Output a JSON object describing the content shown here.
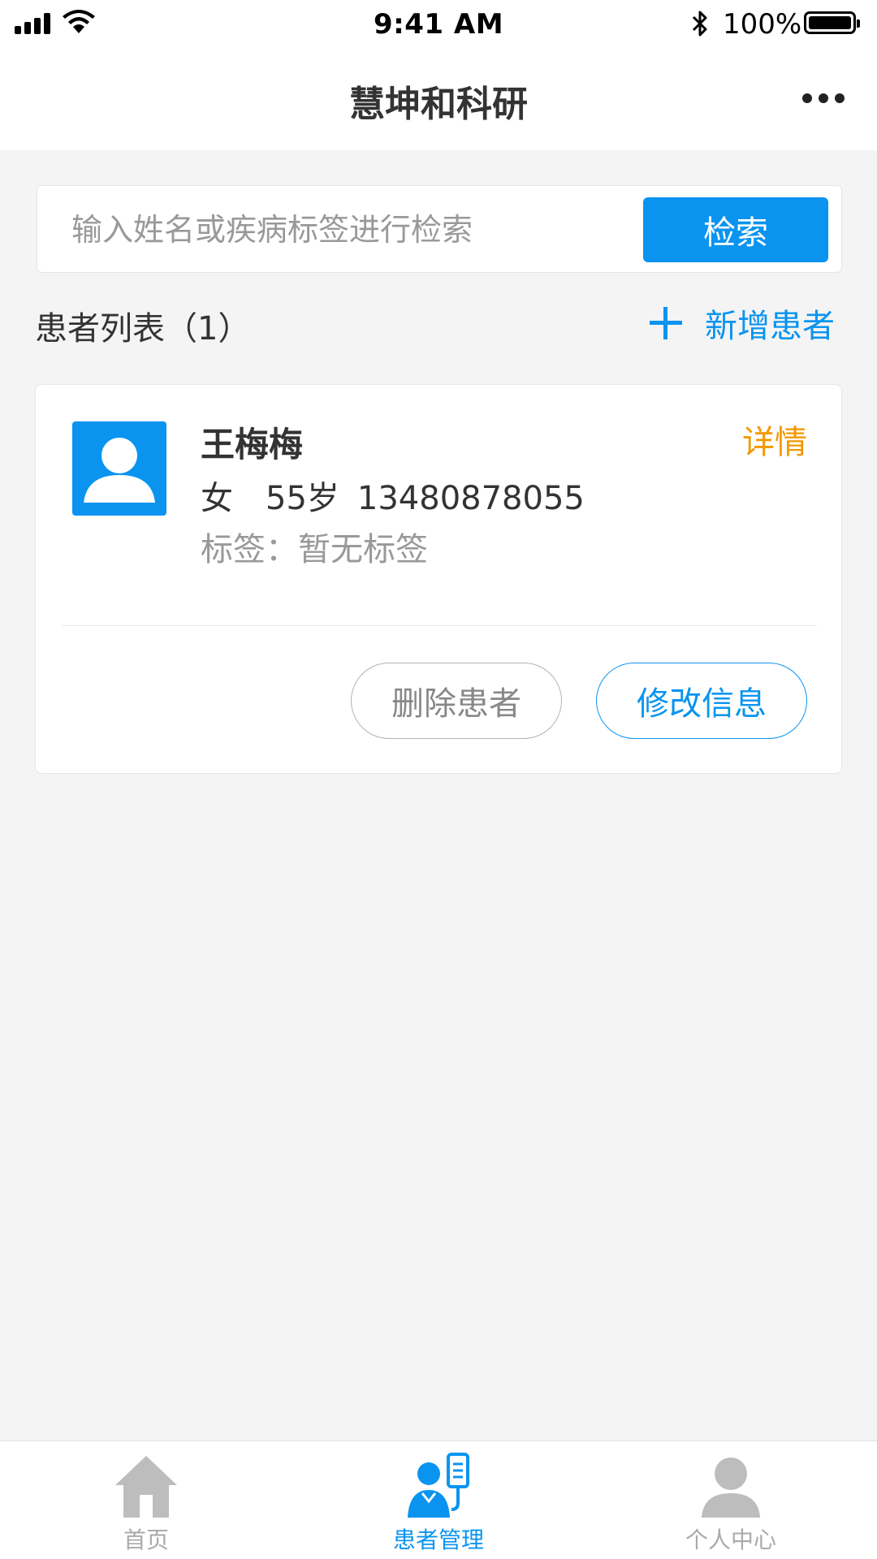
{
  "status_bar": {
    "time": "9:41 AM",
    "battery_percent": "100%",
    "battery_level": 1.0
  },
  "header": {
    "title": "慧坤和科研",
    "more_icon": "more-dots-icon"
  },
  "search": {
    "placeholder": "输入姓名或疾病标签进行检索",
    "value": "",
    "button_label": "检索"
  },
  "list": {
    "title": "患者列表（1）",
    "add_label": "新增患者",
    "add_icon": "plus-icon"
  },
  "patients": [
    {
      "name": "王梅梅",
      "gender": "女",
      "age": "55岁",
      "phone": "13480878055",
      "tags": "标签：暂无标签",
      "detail_label": "详情",
      "delete_label": "删除患者",
      "edit_label": "修改信息",
      "avatar_icon": "user-avatar-icon"
    }
  ],
  "tabs": [
    {
      "label": "首页",
      "icon": "home-icon",
      "active": false
    },
    {
      "label": "患者管理",
      "icon": "patient-management-icon",
      "active": true
    },
    {
      "label": "个人中心",
      "icon": "user-icon",
      "active": false
    }
  ],
  "colors": {
    "primary": "#0a94f0",
    "detail": "#f39800",
    "inactive": "#aaaaaa",
    "background": "#f4f4f4"
  }
}
